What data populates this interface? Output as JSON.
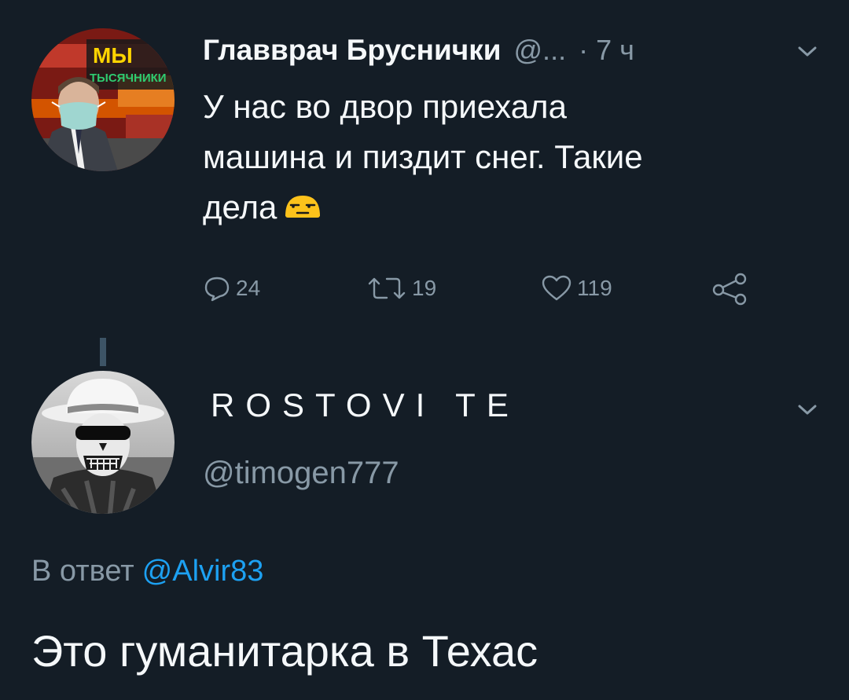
{
  "tweet1": {
    "author_name": "Главврач Бруснички",
    "author_handle_truncated": "@...",
    "timestamp": "· 7 ч",
    "text_lines": [
      "У нас во двор приехала",
      "машина и пиздит снег. Такие",
      "дела"
    ],
    "emoji": "unamused-face",
    "avatar_logo_text": [
      "МЫ",
      "ТЫСЯЧНИКИ"
    ],
    "actions": {
      "reply_count": "24",
      "retweet_count": "19",
      "like_count": "119"
    }
  },
  "tweet2": {
    "author_name": "ROSTOVI TE",
    "author_handle": "@timogen777",
    "reply_prefix": "В ответ",
    "reply_mention": "@Alvir83",
    "text": "Это гуманитарка в Техас"
  },
  "colors": {
    "background": "#141d26",
    "primary_text": "#f5f8fa",
    "secondary_text": "#8899a6",
    "link": "#1da1f2",
    "thread_line": "#3d5466"
  }
}
